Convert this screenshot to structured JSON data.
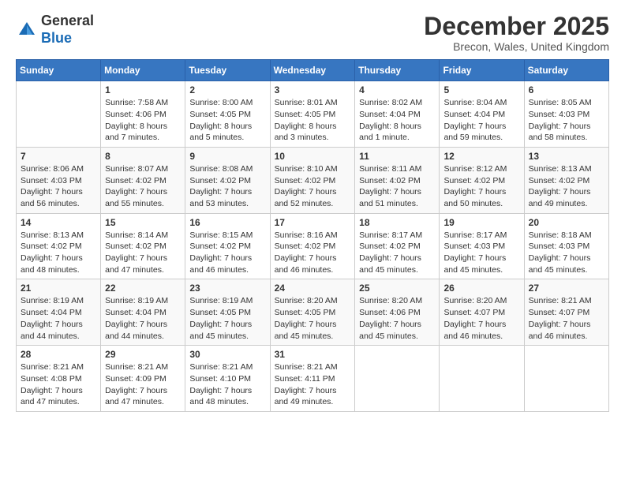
{
  "header": {
    "logo_general": "General",
    "logo_blue": "Blue",
    "month_title": "December 2025",
    "location": "Brecon, Wales, United Kingdom"
  },
  "days_of_week": [
    "Sunday",
    "Monday",
    "Tuesday",
    "Wednesday",
    "Thursday",
    "Friday",
    "Saturday"
  ],
  "weeks": [
    [
      {
        "day": "",
        "info": ""
      },
      {
        "day": "1",
        "info": "Sunrise: 7:58 AM\nSunset: 4:06 PM\nDaylight: 8 hours\nand 7 minutes."
      },
      {
        "day": "2",
        "info": "Sunrise: 8:00 AM\nSunset: 4:05 PM\nDaylight: 8 hours\nand 5 minutes."
      },
      {
        "day": "3",
        "info": "Sunrise: 8:01 AM\nSunset: 4:05 PM\nDaylight: 8 hours\nand 3 minutes."
      },
      {
        "day": "4",
        "info": "Sunrise: 8:02 AM\nSunset: 4:04 PM\nDaylight: 8 hours\nand 1 minute."
      },
      {
        "day": "5",
        "info": "Sunrise: 8:04 AM\nSunset: 4:04 PM\nDaylight: 7 hours\nand 59 minutes."
      },
      {
        "day": "6",
        "info": "Sunrise: 8:05 AM\nSunset: 4:03 PM\nDaylight: 7 hours\nand 58 minutes."
      }
    ],
    [
      {
        "day": "7",
        "info": "Sunrise: 8:06 AM\nSunset: 4:03 PM\nDaylight: 7 hours\nand 56 minutes."
      },
      {
        "day": "8",
        "info": "Sunrise: 8:07 AM\nSunset: 4:02 PM\nDaylight: 7 hours\nand 55 minutes."
      },
      {
        "day": "9",
        "info": "Sunrise: 8:08 AM\nSunset: 4:02 PM\nDaylight: 7 hours\nand 53 minutes."
      },
      {
        "day": "10",
        "info": "Sunrise: 8:10 AM\nSunset: 4:02 PM\nDaylight: 7 hours\nand 52 minutes."
      },
      {
        "day": "11",
        "info": "Sunrise: 8:11 AM\nSunset: 4:02 PM\nDaylight: 7 hours\nand 51 minutes."
      },
      {
        "day": "12",
        "info": "Sunrise: 8:12 AM\nSunset: 4:02 PM\nDaylight: 7 hours\nand 50 minutes."
      },
      {
        "day": "13",
        "info": "Sunrise: 8:13 AM\nSunset: 4:02 PM\nDaylight: 7 hours\nand 49 minutes."
      }
    ],
    [
      {
        "day": "14",
        "info": "Sunrise: 8:13 AM\nSunset: 4:02 PM\nDaylight: 7 hours\nand 48 minutes."
      },
      {
        "day": "15",
        "info": "Sunrise: 8:14 AM\nSunset: 4:02 PM\nDaylight: 7 hours\nand 47 minutes."
      },
      {
        "day": "16",
        "info": "Sunrise: 8:15 AM\nSunset: 4:02 PM\nDaylight: 7 hours\nand 46 minutes."
      },
      {
        "day": "17",
        "info": "Sunrise: 8:16 AM\nSunset: 4:02 PM\nDaylight: 7 hours\nand 46 minutes."
      },
      {
        "day": "18",
        "info": "Sunrise: 8:17 AM\nSunset: 4:02 PM\nDaylight: 7 hours\nand 45 minutes."
      },
      {
        "day": "19",
        "info": "Sunrise: 8:17 AM\nSunset: 4:03 PM\nDaylight: 7 hours\nand 45 minutes."
      },
      {
        "day": "20",
        "info": "Sunrise: 8:18 AM\nSunset: 4:03 PM\nDaylight: 7 hours\nand 45 minutes."
      }
    ],
    [
      {
        "day": "21",
        "info": "Sunrise: 8:19 AM\nSunset: 4:04 PM\nDaylight: 7 hours\nand 44 minutes."
      },
      {
        "day": "22",
        "info": "Sunrise: 8:19 AM\nSunset: 4:04 PM\nDaylight: 7 hours\nand 44 minutes."
      },
      {
        "day": "23",
        "info": "Sunrise: 8:19 AM\nSunset: 4:05 PM\nDaylight: 7 hours\nand 45 minutes."
      },
      {
        "day": "24",
        "info": "Sunrise: 8:20 AM\nSunset: 4:05 PM\nDaylight: 7 hours\nand 45 minutes."
      },
      {
        "day": "25",
        "info": "Sunrise: 8:20 AM\nSunset: 4:06 PM\nDaylight: 7 hours\nand 45 minutes."
      },
      {
        "day": "26",
        "info": "Sunrise: 8:20 AM\nSunset: 4:07 PM\nDaylight: 7 hours\nand 46 minutes."
      },
      {
        "day": "27",
        "info": "Sunrise: 8:21 AM\nSunset: 4:07 PM\nDaylight: 7 hours\nand 46 minutes."
      }
    ],
    [
      {
        "day": "28",
        "info": "Sunrise: 8:21 AM\nSunset: 4:08 PM\nDaylight: 7 hours\nand 47 minutes."
      },
      {
        "day": "29",
        "info": "Sunrise: 8:21 AM\nSunset: 4:09 PM\nDaylight: 7 hours\nand 47 minutes."
      },
      {
        "day": "30",
        "info": "Sunrise: 8:21 AM\nSunset: 4:10 PM\nDaylight: 7 hours\nand 48 minutes."
      },
      {
        "day": "31",
        "info": "Sunrise: 8:21 AM\nSunset: 4:11 PM\nDaylight: 7 hours\nand 49 minutes."
      },
      {
        "day": "",
        "info": ""
      },
      {
        "day": "",
        "info": ""
      },
      {
        "day": "",
        "info": ""
      }
    ]
  ]
}
